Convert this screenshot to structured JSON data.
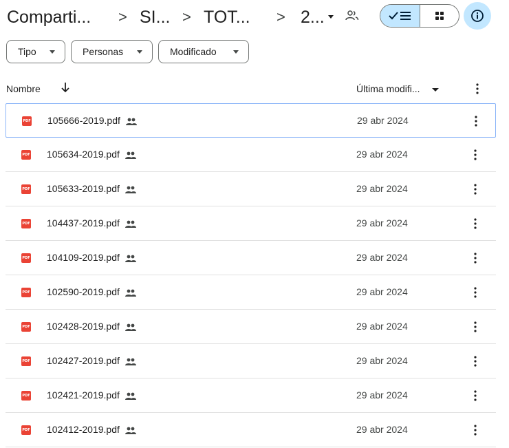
{
  "breadcrumb": {
    "items": [
      "Comparti...",
      "SI...",
      "TOT...",
      "2..."
    ],
    "separator": ">"
  },
  "header_icons": {
    "people": "people-outline-icon",
    "list_view": "check-list-icon",
    "grid_view": "grid-icon",
    "info": "info-icon"
  },
  "filters": [
    {
      "label": "Tipo"
    },
    {
      "label": "Personas"
    },
    {
      "label": "Modificado"
    }
  ],
  "columns": {
    "name": "Nombre",
    "modified": "Última modifi..."
  },
  "files": [
    {
      "name": "105666-2019.pdf",
      "date": "29 abr 2024",
      "selected": true
    },
    {
      "name": "105634-2019.pdf",
      "date": "29 abr 2024"
    },
    {
      "name": "105633-2019.pdf",
      "date": "29 abr 2024"
    },
    {
      "name": "104437-2019.pdf",
      "date": "29 abr 2024"
    },
    {
      "name": "104109-2019.pdf",
      "date": "29 abr 2024"
    },
    {
      "name": "102590-2019.pdf",
      "date": "29 abr 2024"
    },
    {
      "name": "102428-2019.pdf",
      "date": "29 abr 2024"
    },
    {
      "name": "102427-2019.pdf",
      "date": "29 abr 2024"
    },
    {
      "name": "102421-2019.pdf",
      "date": "29 abr 2024"
    },
    {
      "name": "102412-2019.pdf",
      "date": "29 abr 2024"
    }
  ],
  "file_icon_label": "PDF",
  "colors": {
    "accent": "#c2e7ff",
    "pdf": "#ea4335",
    "selection_border": "#8ab4f8"
  }
}
